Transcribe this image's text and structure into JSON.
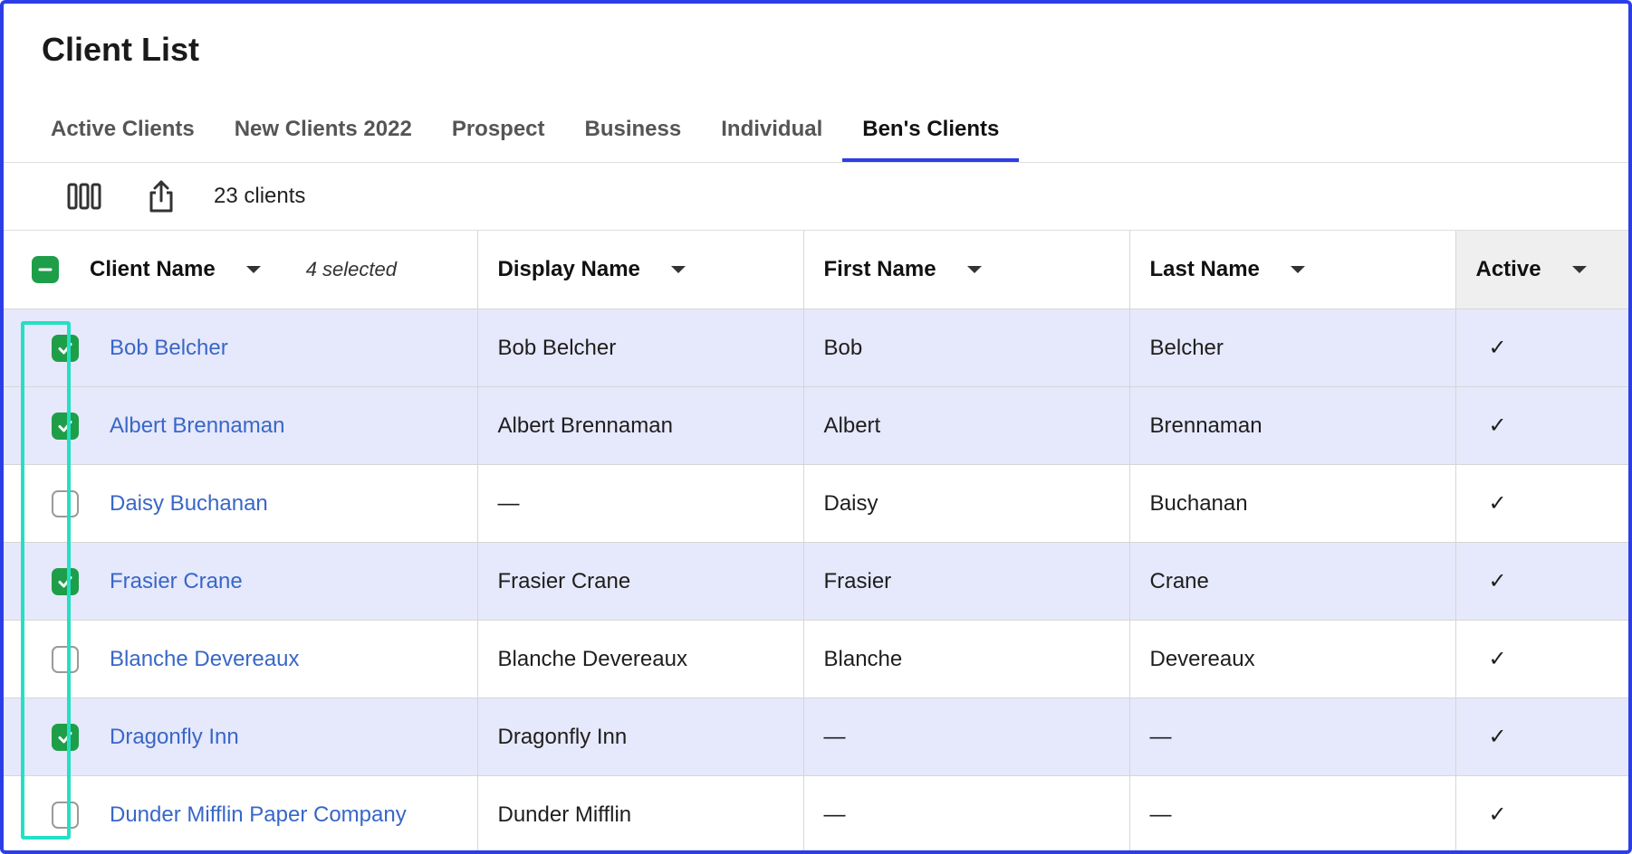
{
  "page": {
    "title": "Client List"
  },
  "tabs": [
    {
      "label": "Active Clients",
      "active": false
    },
    {
      "label": "New Clients 2022",
      "active": false
    },
    {
      "label": "Prospect",
      "active": false
    },
    {
      "label": "Business",
      "active": false
    },
    {
      "label": "Individual",
      "active": false
    },
    {
      "label": "Ben's Clients",
      "active": true
    }
  ],
  "toolbar": {
    "columns_icon": "columns-icon",
    "export_icon": "share-export-icon",
    "count_label": "23 clients"
  },
  "table": {
    "selected_note": "4 selected",
    "columns": [
      {
        "key": "client_name",
        "label": "Client Name"
      },
      {
        "key": "display_name",
        "label": "Display Name"
      },
      {
        "key": "first_name",
        "label": "First Name"
      },
      {
        "key": "last_name",
        "label": "Last Name"
      },
      {
        "key": "active",
        "label": "Active"
      }
    ],
    "rows": [
      {
        "selected": true,
        "client_name": "Bob Belcher",
        "display_name": "Bob Belcher",
        "first_name": "Bob",
        "last_name": "Belcher",
        "active": "✓"
      },
      {
        "selected": true,
        "client_name": "Albert Brennaman",
        "display_name": "Albert Brennaman",
        "first_name": "Albert",
        "last_name": "Brennaman",
        "active": "✓"
      },
      {
        "selected": false,
        "client_name": "Daisy Buchanan",
        "display_name": "—",
        "first_name": "Daisy",
        "last_name": "Buchanan",
        "active": "✓"
      },
      {
        "selected": true,
        "client_name": "Frasier Crane",
        "display_name": "Frasier Crane",
        "first_name": "Frasier",
        "last_name": "Crane",
        "active": "✓"
      },
      {
        "selected": false,
        "client_name": "Blanche Devereaux",
        "display_name": "Blanche Devereaux",
        "first_name": "Blanche",
        "last_name": "Devereaux",
        "active": "✓"
      },
      {
        "selected": true,
        "client_name": "Dragonfly Inn",
        "display_name": "Dragonfly Inn",
        "first_name": "—",
        "last_name": "—",
        "active": "✓"
      },
      {
        "selected": false,
        "client_name": "Dunder Mifflin Paper Company",
        "display_name": "Dunder Mifflin",
        "first_name": "—",
        "last_name": "—",
        "active": "✓"
      }
    ]
  },
  "colors": {
    "accent": "#2b3ee6",
    "checkbox_checked": "#1e9e48",
    "selected_row": "#e6e8fb",
    "link": "#3867c7",
    "highlight": "#23e0c5"
  }
}
